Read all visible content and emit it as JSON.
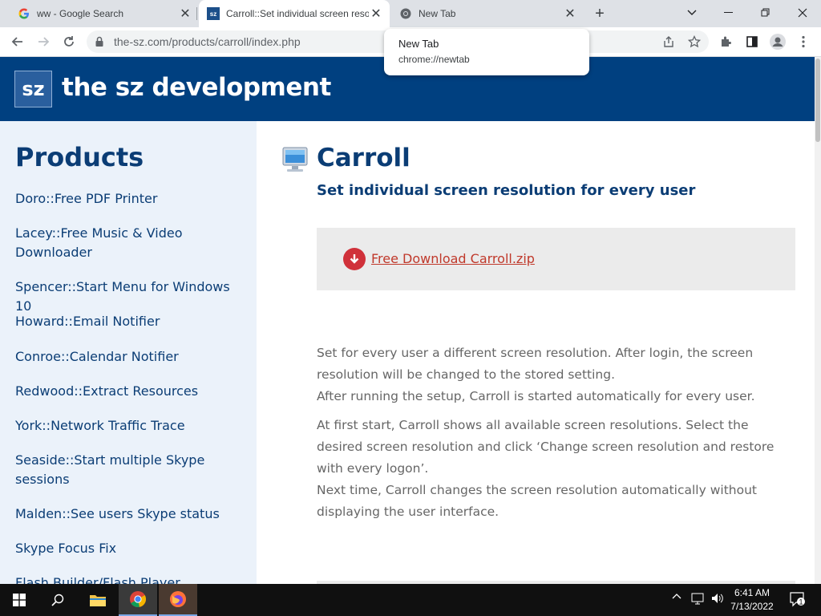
{
  "browser": {
    "tabs": [
      {
        "title": "ww - Google Search",
        "icon": "google-icon"
      },
      {
        "title": "Carroll::Set individual screen reso",
        "icon": "sz-favicon",
        "active": true
      },
      {
        "title": "New Tab",
        "icon": "chrome-icon"
      }
    ],
    "new_tab_symbol": "+",
    "address": "the-sz.com/products/carroll/index.php",
    "tooltip": {
      "title": "New Tab",
      "url": "chrome://newtab"
    }
  },
  "site": {
    "logo_text": "sz",
    "name": "the sz development",
    "brand_color": "#004080"
  },
  "sidebar": {
    "heading": "Products",
    "items": [
      {
        "label": "Doro::Free PDF Printer"
      },
      {
        "label": "Lacey::Free Music & Video Downloader"
      },
      {
        "label": "Spencer::Start Menu for Windows 10"
      },
      {
        "label": "Howard::Email Notifier"
      },
      {
        "label": "Conroe::Calendar Notifier"
      },
      {
        "label": "Redwood::Extract Resources"
      },
      {
        "label": "York::Network Traffic Trace"
      },
      {
        "label": "Seaside::Start multiple Skype sessions"
      },
      {
        "label": "Malden::See users Skype status"
      },
      {
        "label": "Skype Focus Fix"
      },
      {
        "label": "Flash Builder/Flash Player"
      }
    ]
  },
  "product": {
    "title": "Carroll",
    "subtitle": "Set individual screen resolution for every user",
    "download_label": "Free Download Carroll.zip",
    "paragraph1": "Set for every user a different screen resolution. After login, the screen resolution will be changed to the stored setting.",
    "paragraph2": "After running the setup, Carroll is started automatically for every user.",
    "paragraph3": "At first start, Carroll shows all available screen resolutions. Select the desired screen resolution and click ‘Change screen resolution and restore with every logon’.",
    "paragraph4": "Next time, Carroll changes the screen resolution automatically without displaying the user interface."
  },
  "taskbar": {
    "time": "6:41 AM",
    "date": "7/13/2022",
    "notification_count": "1"
  }
}
